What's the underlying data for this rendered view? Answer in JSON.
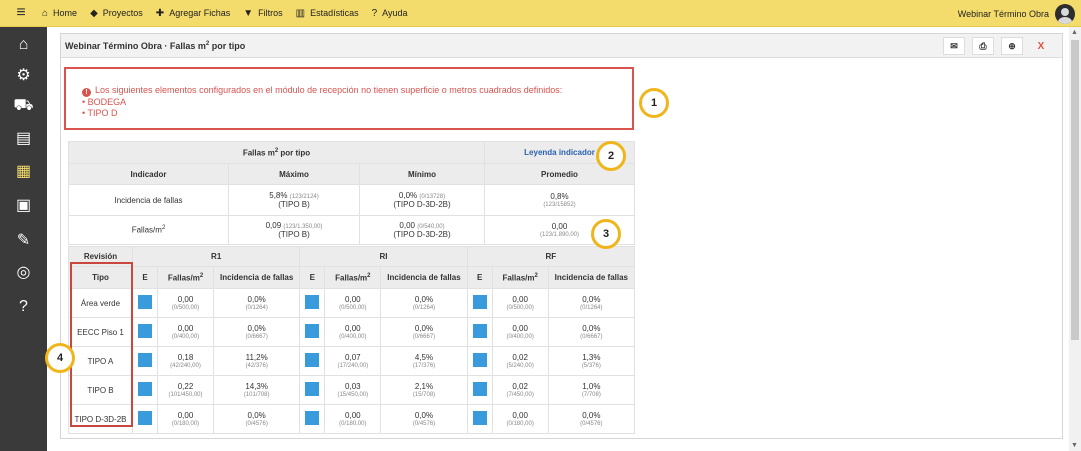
{
  "topbar": {
    "menu_icon": "hamburger-icon",
    "nav": [
      {
        "label": "Home",
        "icon": "home-icon"
      },
      {
        "label": "Proyectos",
        "icon": "tag-icon"
      },
      {
        "label": "Agregar Fichas",
        "icon": "plus-icon"
      },
      {
        "label": "Filtros",
        "icon": "filter-icon"
      },
      {
        "label": "Estadísticas",
        "icon": "bar-chart-icon"
      },
      {
        "label": "Ayuda",
        "icon": "question-icon"
      }
    ],
    "user_name": "Webinar Término Obra"
  },
  "sidebar": {
    "icons": [
      "home-icon",
      "gears-icon",
      "truck-icon",
      "checklist-icon",
      "report-search-icon",
      "id-card-check-icon",
      "tools-icon",
      "analytics-search-icon",
      "help-icon"
    ],
    "active_index": 4
  },
  "panel": {
    "title_prefix": "Webinar Término Obra · Fallas m",
    "title_sup": "2",
    "title_suffix": " por tipo"
  },
  "alert": {
    "icon": "!",
    "message": "Los siguientes elementos configurados en el módulo de recepción no tienen superficie o metros cuadrados definidos:",
    "items": [
      "• BODEGA",
      "• TIPO D"
    ]
  },
  "markers": [
    "1",
    "2",
    "3",
    "4"
  ],
  "summary": {
    "title": "Fallas m",
    "title_sup": "2",
    "title_suffix": " por tipo",
    "legend_link": "Leyenda indicador",
    "columns": [
      "Indicador",
      "Máximo",
      "Mínimo",
      "Promedio"
    ],
    "rows": [
      {
        "indicator": "Incidencia de fallas",
        "max_value": "5,8%",
        "max_detail": "(123/2124)",
        "max_tipo": "(TIPO B)",
        "min_value": "0,0%",
        "min_detail": "(0/13728)",
        "min_tipo": "(TIPO D-3D-2B)",
        "avg_value": "0,8%",
        "avg_detail": "(123/15852)"
      },
      {
        "indicator": "Fallas/m",
        "indicator_sup": "2",
        "max_value": "0,09",
        "max_detail": "(123/1.350,00)",
        "max_tipo": "(TIPO B)",
        "min_value": "0,00",
        "min_detail": "(0/540,00)",
        "min_tipo": "(TIPO D-3D-2B)",
        "avg_value": "0,00",
        "avg_detail": "(123/1.890,00)"
      }
    ]
  },
  "detail": {
    "revision_label": "Revisión",
    "tipo_label": "Tipo",
    "revisions": [
      "R1",
      "RI",
      "RF"
    ],
    "subcols": [
      "E",
      "Fallas/m",
      "Incidencia de fallas"
    ],
    "subcol_sup": "2",
    "rows": [
      {
        "tipo": "Área verde",
        "cells": [
          {
            "f": "0,00",
            "fd": "(0/500,00)",
            "i": "0,0%",
            "id": "(0/1264)"
          },
          {
            "f": "0,00",
            "fd": "(0/500,00)",
            "i": "0,0%",
            "id": "(0/1264)"
          },
          {
            "f": "0,00",
            "fd": "(0/500,00)",
            "i": "0,0%",
            "id": "(0/1264)"
          }
        ]
      },
      {
        "tipo": "EECC Piso 1",
        "cells": [
          {
            "f": "0,00",
            "fd": "(0/400,00)",
            "i": "0,0%",
            "id": "(0/6667)"
          },
          {
            "f": "0,00",
            "fd": "(0/400,00)",
            "i": "0,0%",
            "id": "(0/6667)"
          },
          {
            "f": "0,00",
            "fd": "(0/400,00)",
            "i": "0,0%",
            "id": "(0/6667)"
          }
        ]
      },
      {
        "tipo": "TIPO A",
        "cells": [
          {
            "f": "0,18",
            "fd": "(42/240,00)",
            "i": "11,2%",
            "id": "(42/376)"
          },
          {
            "f": "0,07",
            "fd": "(17/240,00)",
            "i": "4,5%",
            "id": "(17/376)"
          },
          {
            "f": "0,02",
            "fd": "(5/240,00)",
            "i": "1,3%",
            "id": "(5/376)"
          }
        ]
      },
      {
        "tipo": "TIPO B",
        "cells": [
          {
            "f": "0,22",
            "fd": "(101/450,00)",
            "i": "14,3%",
            "id": "(101/708)"
          },
          {
            "f": "0,03",
            "fd": "(15/450,00)",
            "i": "2,1%",
            "id": "(15/708)"
          },
          {
            "f": "0,02",
            "fd": "(7/450,00)",
            "i": "1,0%",
            "id": "(7/708)"
          }
        ]
      },
      {
        "tipo": "TIPO D-3D-2B",
        "cells": [
          {
            "f": "0,00",
            "fd": "(0/180,00)",
            "i": "0,0%",
            "id": "(0/4576)"
          },
          {
            "f": "0,00",
            "fd": "(0/180,00)",
            "i": "0,0%",
            "id": "(0/4576)"
          },
          {
            "f": "0,00",
            "fd": "(0/180,00)",
            "i": "0,0%",
            "id": "(0/4576)"
          }
        ]
      }
    ]
  },
  "colors": {
    "topbar": "#f4dc6c",
    "sidebar": "#3a3a3a",
    "alert": "#d9534f",
    "status_square": "#3a9bdc",
    "marker_ring": "#f1b51c"
  }
}
